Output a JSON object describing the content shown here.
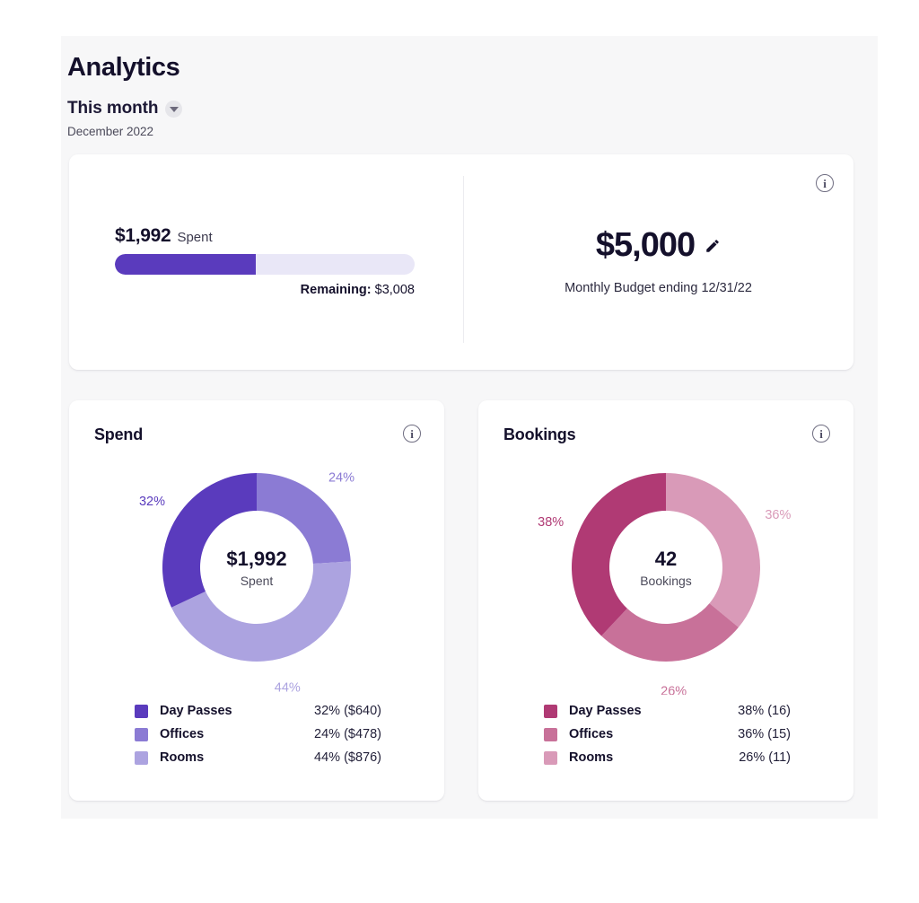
{
  "header": {
    "title": "Analytics",
    "period_label": "This month",
    "period_caret_icon": "chevron-down-icon",
    "period_sub": "December 2022"
  },
  "budget_card": {
    "info_icon": "info-icon",
    "spent_amount": "$1,992",
    "spent_word": "Spent",
    "remaining_label": "Remaining:",
    "remaining_value": "$3,008",
    "progress_percent": 47,
    "budget_amount": "$5,000",
    "edit_icon": "pencil-icon",
    "budget_sub": "Monthly Budget ending 12/31/22"
  },
  "spend_card": {
    "title": "Spend",
    "info_icon": "info-icon",
    "center_value": "$1,992",
    "center_label": "Spent",
    "legend": [
      {
        "name": "Day Passes",
        "value": "32% ($640)",
        "color": "#5a3bbd"
      },
      {
        "name": "Offices",
        "value": "24% ($478)",
        "color": "#8b7bd4"
      },
      {
        "name": "Rooms",
        "value": "44% ($876)",
        "color": "#aca3e0"
      }
    ]
  },
  "bookings_card": {
    "title": "Bookings",
    "info_icon": "info-icon",
    "center_value": "42",
    "center_label": "Bookings",
    "legend": [
      {
        "name": "Day Passes",
        "value": "38% (16)",
        "color": "#b03a74"
      },
      {
        "name": "Offices",
        "value": "36% (15)",
        "color": "#c87199"
      },
      {
        "name": "Rooms",
        "value": "26% (11)",
        "color": "#d99ab8"
      }
    ]
  },
  "chart_data": [
    {
      "type": "pie",
      "title": "Spend",
      "center_value": "$1,992",
      "center_label": "Spent",
      "categories": [
        "Offices",
        "Rooms",
        "Day Passes"
      ],
      "values": [
        24,
        44,
        32
      ],
      "amounts": [
        "$478",
        "$876",
        "$640"
      ],
      "labels": [
        "24%",
        "44%",
        "32%"
      ],
      "colors": [
        "#8b7bd4",
        "#aca3e0",
        "#5a3bbd"
      ],
      "start_angle": 0,
      "direction": "clockwise",
      "legend_position": "bottom"
    },
    {
      "type": "pie",
      "title": "Bookings",
      "center_value": "42",
      "center_label": "Bookings",
      "categories": [
        "Rooms",
        "Offices",
        "Day Passes"
      ],
      "values": [
        36,
        26,
        38
      ],
      "counts": [
        "11",
        "15",
        "16"
      ],
      "labels": [
        "36%",
        "26%",
        "38%"
      ],
      "colors": [
        "#d99ab8",
        "#c87199",
        "#b03a74"
      ],
      "start_angle": 0,
      "direction": "clockwise",
      "legend_position": "bottom"
    }
  ]
}
